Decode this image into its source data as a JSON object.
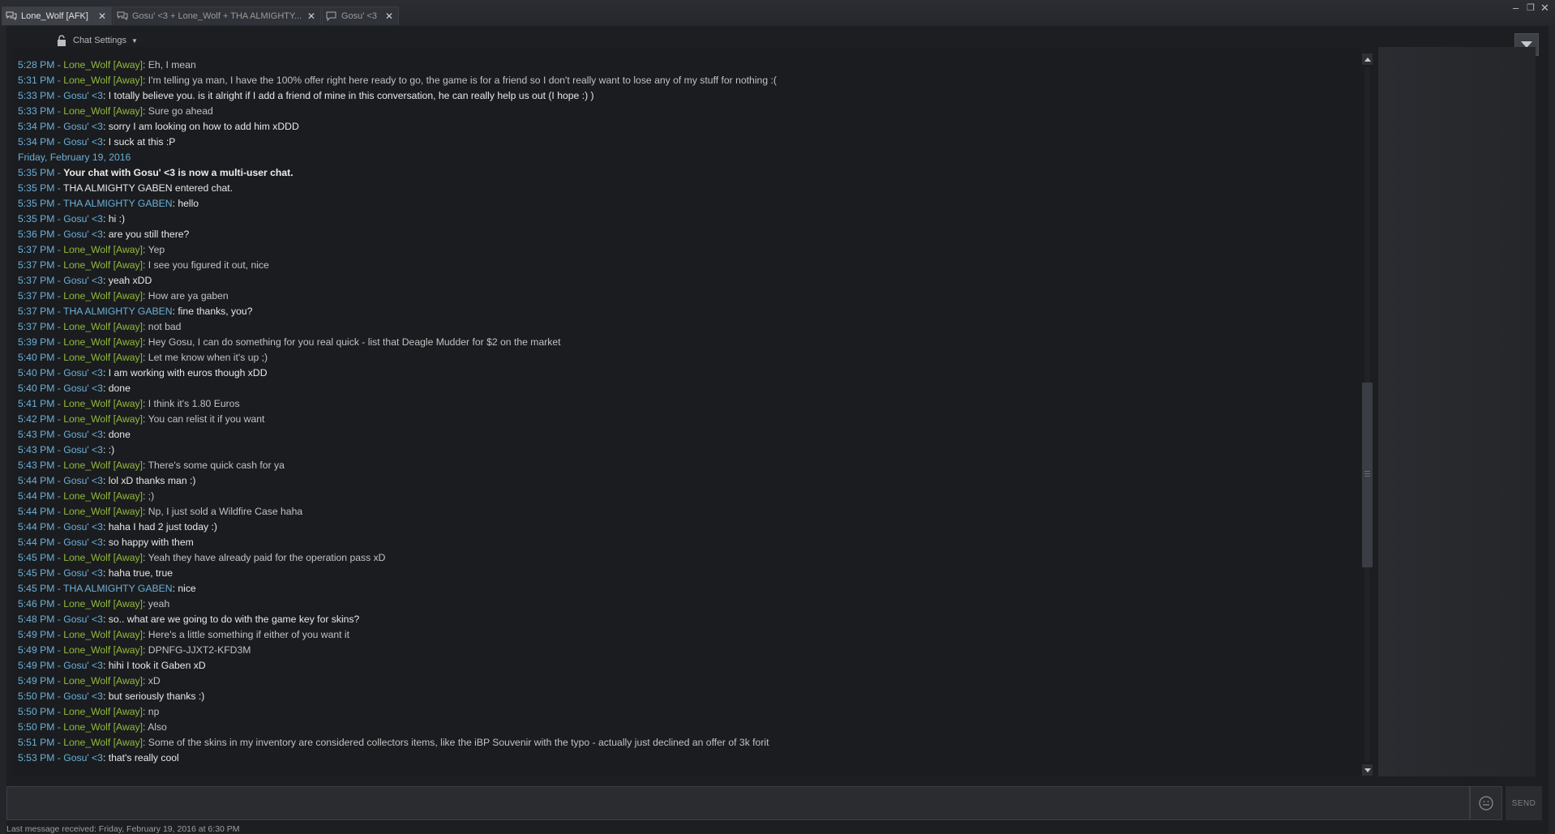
{
  "tabs": [
    {
      "label": "Lone_Wolf [AFK]",
      "active": true
    },
    {
      "label": "Gosu' <3 + Lone_Wolf + THA ALMIGHTY...",
      "active": false
    },
    {
      "label": "Gosu' <3",
      "active": false
    }
  ],
  "window_controls": {
    "minimize": "‒",
    "restore": "❐",
    "close": "✕"
  },
  "chat_settings_label": "Chat Settings",
  "messages": [
    {
      "time": "5:28 PM - ",
      "user": "Lone_Wolf [Away]",
      "kind": "lone",
      "text": ": Eh, I mean"
    },
    {
      "time": "5:31 PM - ",
      "user": "Lone_Wolf [Away]",
      "kind": "lone",
      "text": ": I'm telling ya man, I have the 100% offer right here ready to go, the game is for a friend so I don't really want to lose any of my stuff for nothing :("
    },
    {
      "time": "5:33 PM - ",
      "user": "Gosu' <3",
      "kind": "gosu",
      "text": ": I totally believe you. is it alright if I add a friend of mine in this conversation, he can really help us out (I hope :) )"
    },
    {
      "time": "5:33 PM - ",
      "user": "Lone_Wolf [Away]",
      "kind": "lone",
      "text": ": Sure go ahead"
    },
    {
      "time": "5:34 PM - ",
      "user": "Gosu' <3",
      "kind": "gosu",
      "text": ": sorry I am looking on how to add him xDDD"
    },
    {
      "time": "5:34 PM - ",
      "user": "Gosu' <3",
      "kind": "gosu",
      "text": ": I suck at this :P"
    },
    {
      "kind": "date",
      "text": "Friday, February 19, 2016"
    },
    {
      "time": "5:35 PM - ",
      "kind": "sysbold",
      "text": "Your chat with Gosu' <3 is now a multi-user chat."
    },
    {
      "time": "5:35 PM - ",
      "kind": "sys",
      "text": "THA ALMIGHTY GABEN entered chat."
    },
    {
      "time": "5:35 PM - ",
      "user": "THA ALMIGHTY GABEN",
      "kind": "gaben",
      "text": ": hello"
    },
    {
      "time": "5:35 PM - ",
      "user": "Gosu' <3",
      "kind": "gosu",
      "text": ": hi :)"
    },
    {
      "time": "5:36 PM - ",
      "user": "Gosu' <3",
      "kind": "gosu",
      "text": ": are you still there?"
    },
    {
      "time": "5:37 PM - ",
      "user": "Lone_Wolf [Away]",
      "kind": "lone",
      "text": ": Yep"
    },
    {
      "time": "5:37 PM - ",
      "user": "Lone_Wolf [Away]",
      "kind": "lone",
      "text": ": I see you figured it out, nice"
    },
    {
      "time": "5:37 PM - ",
      "user": "Gosu' <3",
      "kind": "gosu",
      "text": ": yeah xDD"
    },
    {
      "time": "5:37 PM - ",
      "user": "Lone_Wolf [Away]",
      "kind": "lone",
      "text": ": How are ya gaben"
    },
    {
      "time": "5:37 PM - ",
      "user": "THA ALMIGHTY GABEN",
      "kind": "gaben",
      "text": ": fine thanks, you?"
    },
    {
      "time": "5:37 PM - ",
      "user": "Lone_Wolf [Away]",
      "kind": "lone",
      "text": ": not bad"
    },
    {
      "time": "5:39 PM - ",
      "user": "Lone_Wolf [Away]",
      "kind": "lone",
      "text": ": Hey Gosu, I can do something for you real quick - list that Deagle Mudder for $2 on the market"
    },
    {
      "time": "5:40 PM - ",
      "user": "Lone_Wolf [Away]",
      "kind": "lone",
      "text": ": Let me know when it's up ;)"
    },
    {
      "time": "5:40 PM - ",
      "user": "Gosu' <3",
      "kind": "gosu",
      "text": ": I am working with euros though xDD"
    },
    {
      "time": "5:40 PM - ",
      "user": "Gosu' <3",
      "kind": "gosu",
      "text": ": done"
    },
    {
      "time": "5:41 PM - ",
      "user": "Lone_Wolf [Away]",
      "kind": "lone",
      "text": ": I think it's 1.80 Euros"
    },
    {
      "time": "5:42 PM - ",
      "user": "Lone_Wolf [Away]",
      "kind": "lone",
      "text": ": You can relist it if you want"
    },
    {
      "time": "5:43 PM - ",
      "user": "Gosu' <3",
      "kind": "gosu",
      "text": ": done"
    },
    {
      "time": "5:43 PM - ",
      "user": "Gosu' <3",
      "kind": "gosu",
      "text": ": :)"
    },
    {
      "time": "5:43 PM - ",
      "user": "Lone_Wolf [Away]",
      "kind": "lone",
      "text": ": There's some quick cash for ya"
    },
    {
      "time": "5:44 PM - ",
      "user": "Gosu' <3",
      "kind": "gosu",
      "text": ": lol xD thanks man :)"
    },
    {
      "time": "5:44 PM - ",
      "user": "Lone_Wolf [Away]",
      "kind": "lone",
      "text": ": ;)"
    },
    {
      "time": "5:44 PM - ",
      "user": "Lone_Wolf [Away]",
      "kind": "lone",
      "text": ": Np, I just sold a Wildfire Case haha"
    },
    {
      "time": "5:44 PM - ",
      "user": "Gosu' <3",
      "kind": "gosu",
      "text": ": haha I had 2 just today :)"
    },
    {
      "time": "5:44 PM - ",
      "user": "Gosu' <3",
      "kind": "gosu",
      "text": ": so happy with them"
    },
    {
      "time": "5:45 PM - ",
      "user": "Lone_Wolf [Away]",
      "kind": "lone",
      "text": ": Yeah they have already paid for the operation pass xD"
    },
    {
      "time": "5:45 PM - ",
      "user": "Gosu' <3",
      "kind": "gosu",
      "text": ": haha true, true"
    },
    {
      "time": "5:45 PM - ",
      "user": "THA ALMIGHTY GABEN",
      "kind": "gaben",
      "text": ": nice"
    },
    {
      "time": "5:46 PM - ",
      "user": "Lone_Wolf [Away]",
      "kind": "lone",
      "text": ": yeah"
    },
    {
      "time": "5:48 PM - ",
      "user": "Gosu' <3",
      "kind": "gosu",
      "text": ": so.. what are we going to do with the game key for skins?"
    },
    {
      "time": "5:49 PM - ",
      "user": "Lone_Wolf [Away]",
      "kind": "lone",
      "text": ": Here's a little something if either of you want it"
    },
    {
      "time": "5:49 PM - ",
      "user": "Lone_Wolf [Away]",
      "kind": "lone",
      "text": ": DPNFG-JJXT2-KFD3M"
    },
    {
      "time": "5:49 PM - ",
      "user": "Gosu' <3",
      "kind": "gosu",
      "text": ": hihi I took it Gaben xD"
    },
    {
      "time": "5:49 PM - ",
      "user": "Lone_Wolf [Away]",
      "kind": "lone",
      "text": ": xD"
    },
    {
      "time": "5:50 PM - ",
      "user": "Gosu' <3",
      "kind": "gosu",
      "text": ": but seriously thanks :)"
    },
    {
      "time": "5:50 PM - ",
      "user": "Lone_Wolf [Away]",
      "kind": "lone",
      "text": ": np"
    },
    {
      "time": "5:50 PM - ",
      "user": "Lone_Wolf [Away]",
      "kind": "lone",
      "text": ": Also"
    },
    {
      "time": "5:51 PM - ",
      "user": "Lone_Wolf [Away]",
      "kind": "lone",
      "text": ": Some of the skins in my inventory are considered collectors items, like the iBP Souvenir with the typo - actually just declined an offer of 3k forit"
    },
    {
      "time": "5:53 PM - ",
      "user": "Gosu' <3",
      "kind": "gosu",
      "text": ": that's really cool"
    }
  ],
  "input": {
    "value": "",
    "placeholder": ""
  },
  "send_label": "SEND",
  "footer_text": "Last message received: Friday, February 19, 2016 at 6:30 PM",
  "colors": {
    "timestamp": "#6ab0d8",
    "lone_wolf": "#90ba3c",
    "gosu": "#6ab0d8",
    "background": "#1d1e21"
  }
}
